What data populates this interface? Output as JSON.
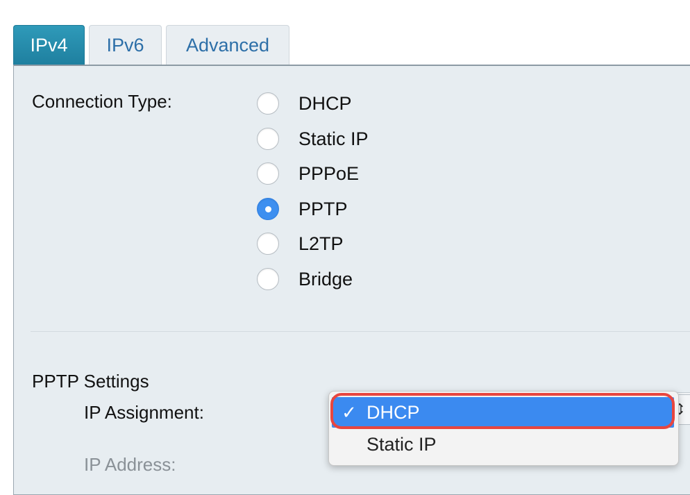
{
  "tabs": [
    {
      "label": "IPv4",
      "active": true
    },
    {
      "label": "IPv6",
      "active": false
    },
    {
      "label": "Advanced",
      "active": false
    }
  ],
  "connection_type": {
    "label": "Connection Type:",
    "options": [
      "DHCP",
      "Static IP",
      "PPPoE",
      "PPTP",
      "L2TP",
      "Bridge"
    ],
    "selected": "PPTP"
  },
  "pptp": {
    "section_title": "PPTP Settings",
    "ip_assignment_label": "IP Assignment:",
    "ip_address_label": "IP Address:",
    "dropdown": {
      "options": [
        "DHCP",
        "Static IP"
      ],
      "selected": "DHCP",
      "check_glyph": "✓"
    }
  },
  "colors": {
    "active_tab": "#2f9ab9",
    "selected_option": "#3b8af0",
    "highlight": "#e8463f"
  }
}
